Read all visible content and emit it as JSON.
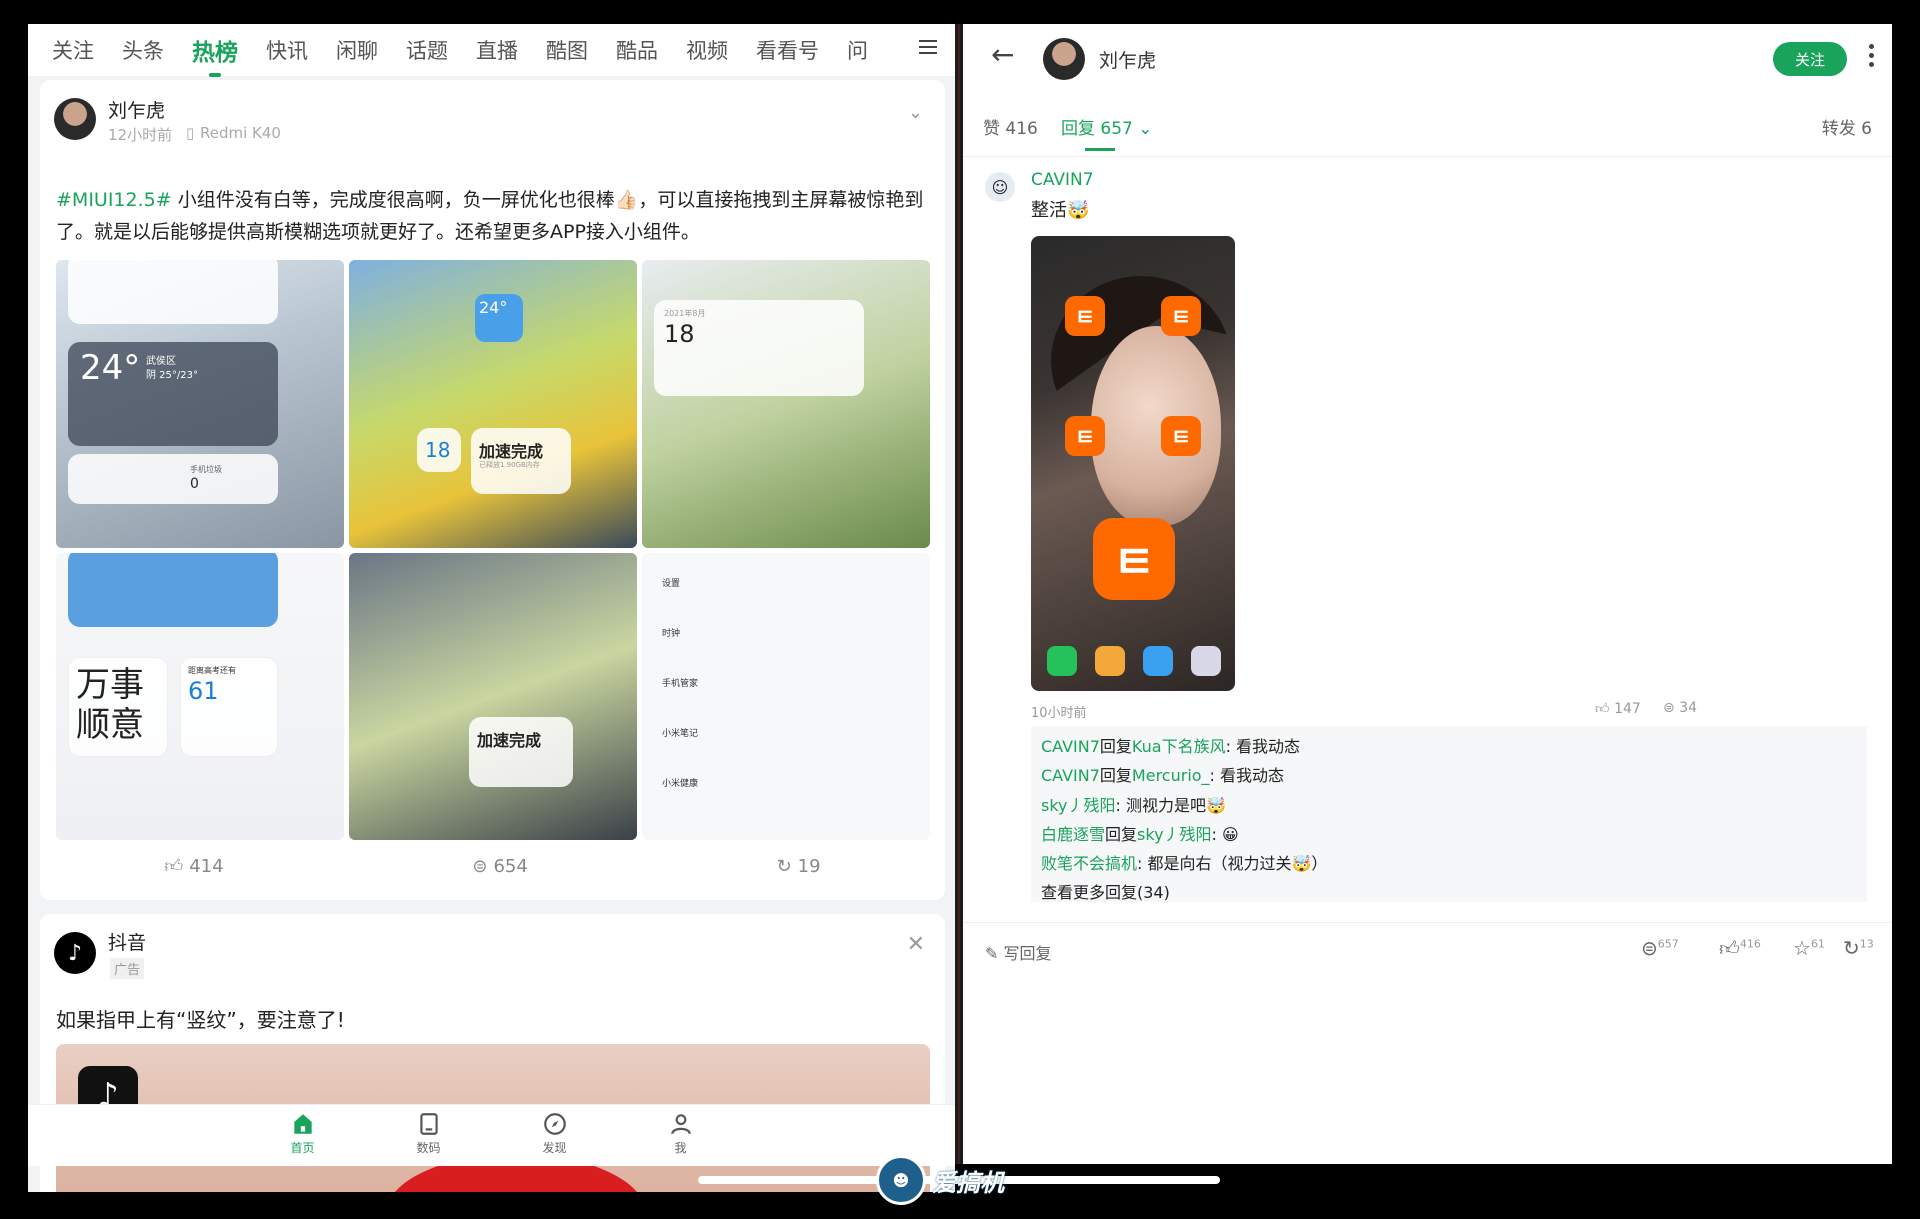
{
  "left": {
    "tabs": [
      "关注",
      "头条",
      "热榜",
      "快讯",
      "闲聊",
      "话题",
      "直播",
      "酷图",
      "酷品",
      "视频",
      "看看号",
      "问"
    ],
    "active_tab": "热榜",
    "post": {
      "author": "刘乍虎",
      "time": "12小时前",
      "device": "Redmi K40",
      "tag": "#MIUI12.5#",
      "text": "小组件没有白等，完成度很高啊，负一屏优化也很棒👍🏻，可以直接拖拽到主屏幕被惊艳到了。就是以后能够提供高斯模糊选项就更好了。还希望更多APP接入小组件。",
      "thumb_texts": {
        "weather_temp": "24°",
        "weather_loc": "武侯区",
        "weather_desc": "阴 25°/23°",
        "trash": "0",
        "trash_label": "手机垃圾",
        "calendar_day": "18",
        "calendar_month": "2021年8月",
        "boost": "加速完成",
        "boost_sub": "已释放1.90GB内存",
        "date_num": "18",
        "chars": "万事顺意",
        "exam_label": "距离高考还有",
        "exam_days": "61",
        "settings_items": [
          "设置",
          "时钟",
          "手机管家",
          "小米笔记",
          "小米健康"
        ]
      },
      "likes": "414",
      "comments": "654",
      "shares": "19"
    },
    "ad": {
      "author": "抖音",
      "badge": "广告",
      "text": "如果指甲上有“竖纹”，要注意了!"
    },
    "bottom_nav": [
      {
        "label": "首页",
        "icon": "home-icon"
      },
      {
        "label": "数码",
        "icon": "tablet-icon"
      },
      {
        "label": "发现",
        "icon": "compass-icon"
      },
      {
        "label": "我",
        "icon": "user-icon"
      }
    ]
  },
  "right": {
    "author": "刘乍虎",
    "follow_label": "关注",
    "like_tab": "赞 416",
    "reply_tab": "回复 657",
    "forward_tab": "转发 6",
    "comment": {
      "user": "CAVIN7",
      "text": "整活🤯",
      "time": "10小时前",
      "likes": "147",
      "comments": "34"
    },
    "replies": [
      {
        "user": "CAVIN7",
        "mid": "回复",
        "target": "Kua下名族风",
        "text": ": 看我动态"
      },
      {
        "user": "CAVIN7",
        "mid": "回复",
        "target": "Mercurio_",
        "text": ": 看我动态"
      },
      {
        "user": "sky丿残阳",
        "mid": "",
        "target": "",
        "text": ": 测视力是吧🤯"
      },
      {
        "user": "白鹿逐雪",
        "mid": "回复",
        "target": "sky丿残阳",
        "text": ": 😀"
      },
      {
        "user": "败笔不会搞机",
        "mid": "",
        "target": "",
        "text": ": 都是向右（视力过关🤯）"
      }
    ],
    "more_replies": "查看更多回复(34)",
    "write_reply": "写回复",
    "bottom_counts": {
      "comments": "657",
      "likes": "416",
      "stars": "61",
      "shares": "13"
    }
  },
  "colors": {
    "accent": "#1aa35b",
    "mi_orange": "#ff6a00"
  },
  "watermark": "爱搞机"
}
